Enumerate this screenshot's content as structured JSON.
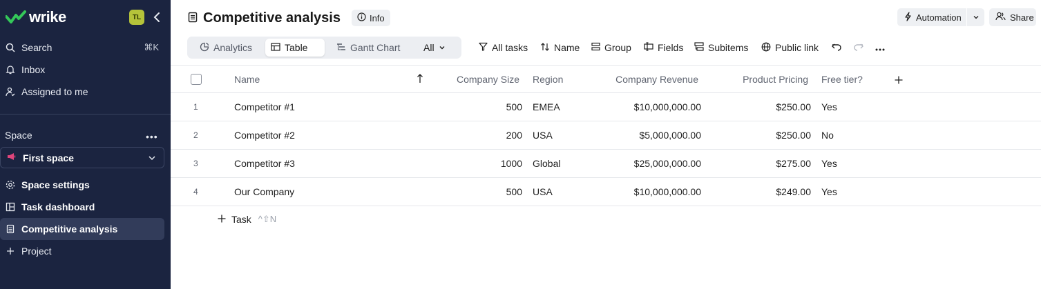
{
  "sidebar": {
    "logo": "wrike",
    "avatar": "TL",
    "search": {
      "label": "Search",
      "shortcut": "⌘K"
    },
    "inbox": "Inbox",
    "assigned": "Assigned to me",
    "space_label": "Space",
    "space_menu": "•••",
    "space_name": "First space",
    "items": [
      {
        "label": "Space settings",
        "icon": "gear-icon"
      },
      {
        "label": "Task dashboard",
        "icon": "dashboard-icon"
      },
      {
        "label": "Competitive analysis",
        "icon": "table-doc-icon",
        "active": true
      },
      {
        "label": "Project",
        "icon": "plus-icon"
      }
    ]
  },
  "header": {
    "title": "Competitive analysis",
    "info": "Info",
    "automation": "Automation",
    "share": "Share"
  },
  "views": {
    "tabs": [
      "Analytics",
      "Table",
      "Gantt Chart",
      "All"
    ],
    "active": "Table"
  },
  "toolbar": {
    "all_tasks": "All tasks",
    "sort": "Name",
    "group": "Group",
    "fields": "Fields",
    "subitems": "Subitems",
    "public_link": "Public link"
  },
  "table": {
    "columns": [
      "Name",
      "Company Size",
      "Region",
      "Company Revenue",
      "Product Pricing",
      "Free tier?"
    ],
    "rows": [
      {
        "n": "1",
        "name": "Competitor #1",
        "size": "500",
        "region": "EMEA",
        "revenue": "$10,000,000.00",
        "pricing": "$250.00",
        "free": "Yes"
      },
      {
        "n": "2",
        "name": "Competitor #2",
        "size": "200",
        "region": "USA",
        "revenue": "$5,000,000.00",
        "pricing": "$250.00",
        "free": "No"
      },
      {
        "n": "3",
        "name": "Competitor #3",
        "size": "1000",
        "region": "Global",
        "revenue": "$25,000,000.00",
        "pricing": "$275.00",
        "free": "Yes"
      },
      {
        "n": "4",
        "name": "Our Company",
        "size": "500",
        "region": "USA",
        "revenue": "$10,000,000.00",
        "pricing": "$249.00",
        "free": "Yes"
      }
    ],
    "add_task": "Task",
    "add_task_shortcut": "^⇧N"
  },
  "colors": {
    "sidebar_bg": "#1b2440",
    "logo_green": "#34c759",
    "avatar": "#b5c33a"
  }
}
